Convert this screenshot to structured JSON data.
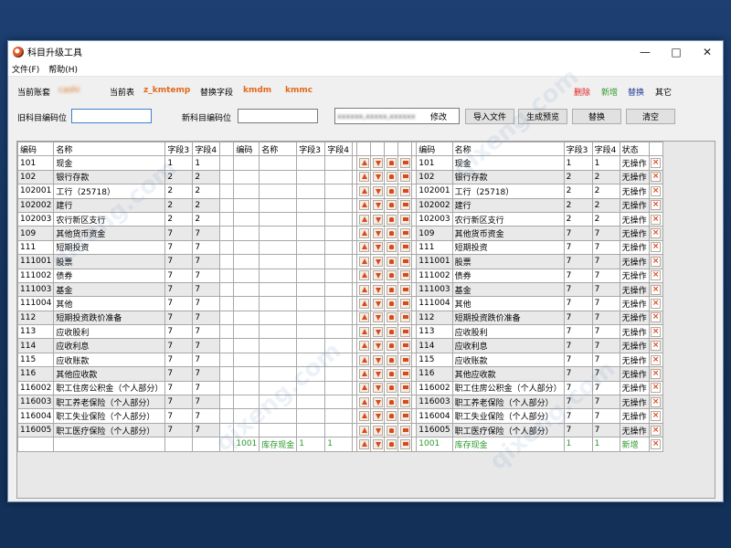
{
  "window": {
    "title": "科目升级工具"
  },
  "menu": [
    "文件(F)",
    "帮助(H)"
  ],
  "topbar": {
    "current_ledger_label": "当前账套",
    "current_ledger_value": "cashi",
    "current_table_label": "当前表",
    "current_table_value": "z_kmtemp",
    "replace_field_label": "替换字段",
    "field1": "kmdm",
    "field2": "kmmc",
    "legend_delete": "删除",
    "legend_add": "新增",
    "legend_replace": "替换",
    "legend_other": "其它"
  },
  "form": {
    "old_code_label": "旧科目编码位",
    "old_code_value": "",
    "new_code_label": "新科目编码位",
    "new_code_value": "",
    "blurred_text": "xxxxxx,xxxxx,xxxxxx",
    "modify_label": "修改",
    "import_button": "导入文件",
    "preview_button": "生成预览",
    "replace_button": "替换",
    "clear_button": "清空"
  },
  "grid": {
    "left_headers": [
      "编码",
      "名称",
      "字段3",
      "字段4"
    ],
    "mid_headers": [
      "编码",
      "名称",
      "字段3",
      "字段4"
    ],
    "right_headers": [
      "编码",
      "名称",
      "字段3",
      "字段4",
      "状态"
    ],
    "rows": [
      [
        "101",
        "现金",
        "1",
        "1"
      ],
      [
        "102",
        "银行存款",
        "2",
        "2"
      ],
      [
        "102001",
        "工行（25718）",
        "2",
        "2"
      ],
      [
        "102002",
        "建行",
        "2",
        "2"
      ],
      [
        "102003",
        "农行新区支行",
        "2",
        "2"
      ],
      [
        "109",
        "其他货币资金",
        "7",
        "7"
      ],
      [
        "111",
        "短期投资",
        "7",
        "7"
      ],
      [
        "111001",
        "股票",
        "7",
        "7"
      ],
      [
        "111002",
        "债券",
        "7",
        "7"
      ],
      [
        "111003",
        "基金",
        "7",
        "7"
      ],
      [
        "111004",
        "其他",
        "7",
        "7"
      ],
      [
        "112",
        "短期投资跌价准备",
        "7",
        "7"
      ],
      [
        "113",
        "应收股利",
        "7",
        "7"
      ],
      [
        "114",
        "应收利息",
        "7",
        "7"
      ],
      [
        "115",
        "应收账款",
        "7",
        "7"
      ],
      [
        "116",
        "其他应收款",
        "7",
        "7"
      ],
      [
        "116002",
        "职工住房公积金（个人部分）",
        "7",
        "7"
      ],
      [
        "116003",
        "职工养老保险（个人部分）",
        "7",
        "7"
      ],
      [
        "116004",
        "职工失业保险（个人部分）",
        "7",
        "7"
      ],
      [
        "116005",
        "职工医疗保险（个人部分）",
        "7",
        "7"
      ]
    ],
    "status_text": "无操作",
    "new_row": {
      "code": "1001",
      "name": "库存现金",
      "f3": "1",
      "f4": "1",
      "status": "新增"
    }
  },
  "colors": {
    "accent": "#e06a1a",
    "delete": "#e02020",
    "add": "#2a9a2a",
    "replace": "#203a9a"
  }
}
